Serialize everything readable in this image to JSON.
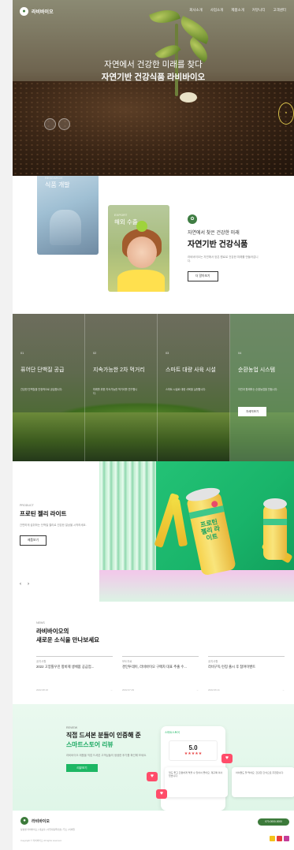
{
  "header": {
    "logo_text": "라비바이오",
    "nav": [
      "회사소개",
      "사업소개",
      "제품소개",
      "커뮤니티",
      "고객센터"
    ]
  },
  "hero": {
    "line1": "자연에서 건강한 미래를 찾다",
    "line2": "자연기반 건강식품 라비바이오"
  },
  "intro": {
    "card1_label": "RESEARCH",
    "card1_title": "식품 개발",
    "card2_label": "EXPORT",
    "card2_title": "해외 수출",
    "subtitle": "자연에서 찾은 건강한 미래",
    "title": "자연기반 건강식품",
    "description": "라비바이오는 자연에서 얻은 원료로 건강한 미래를 만들어갑니다.",
    "button": "더 알아보기"
  },
  "business": {
    "columns": [
      {
        "num": "01",
        "title": "퓨어단 단백질 공급",
        "desc": "건강한 단백질을 안정적으로 공급합니다."
      },
      {
        "num": "02",
        "title": "지속가능한 2차 먹거리",
        "desc": "미래를 위한 지속가능한 먹거리를 연구합니다."
      },
      {
        "num": "03",
        "title": "스마트 대량 사육 시설",
        "desc": "스마트 시설로 대량 사육을 실현합니다."
      },
      {
        "num": "04",
        "title": "순환농업 시스템",
        "desc": "자연과 함께하는 순환농업을 만듭니다."
      }
    ],
    "more": "자세히보기"
  },
  "product": {
    "label": "PRODUCT",
    "title": "프로틴 젤리 라이트",
    "description": "간편하게 섭취하는 단백질 젤리로 건강한 일상을 시작하세요.",
    "button": "제품보기",
    "prev": "‹",
    "next": "›",
    "can_label": "프로틴 젤리 라이트"
  },
  "news": {
    "label": "NEWS",
    "title1": "라비바이오의",
    "title2": "새로운 소식을 만나보세요",
    "items": [
      {
        "cat": "공지사항",
        "title": "2022 고양틀우진 항비제 생체품 공급업...",
        "date": "2022.08.16"
      },
      {
        "cat": "보도자료",
        "title": "경인투데이, 라비바이오 구매차 대표 추출 수...",
        "date": "2022.07.29"
      },
      {
        "cat": "공지사항",
        "title": "라비구독 런칭 출시 후 참여이벤트",
        "date": "2022.06.11"
      }
    ]
  },
  "review": {
    "label": "REVIEW",
    "title1": "직접 드셔본 분들이 인증해 준",
    "title2": "스마트스토어 리뷰",
    "description": "라비바이오 제품을 직접 드셔본 고객님들의 생생한 후기를 확인해 보세요.",
    "button": "리뷰보기",
    "app_title": "스마트스토어",
    "score": "5.0",
    "stars": "★★★★★",
    "card1": "맛도 좋고 간편하게 먹을 수 있어서 좋아요. 재구매 의사 있습니다.",
    "card2": "아이들도 잘 먹어요. 건강한 간식으로 추천합니다."
  },
  "footer": {
    "logo_text": "라비바이오",
    "info": "상호명 라비바이오 | 대표자 | 사업자등록번호 | 주소 | 이메일",
    "copyright": "Copyright © 라비바이오 All rights reserved.",
    "phone": "070-0000-0000"
  },
  "colors": {
    "brand_green": "#3c7a3a",
    "accent_green": "#1db764",
    "heart": "#ff4d6a"
  }
}
